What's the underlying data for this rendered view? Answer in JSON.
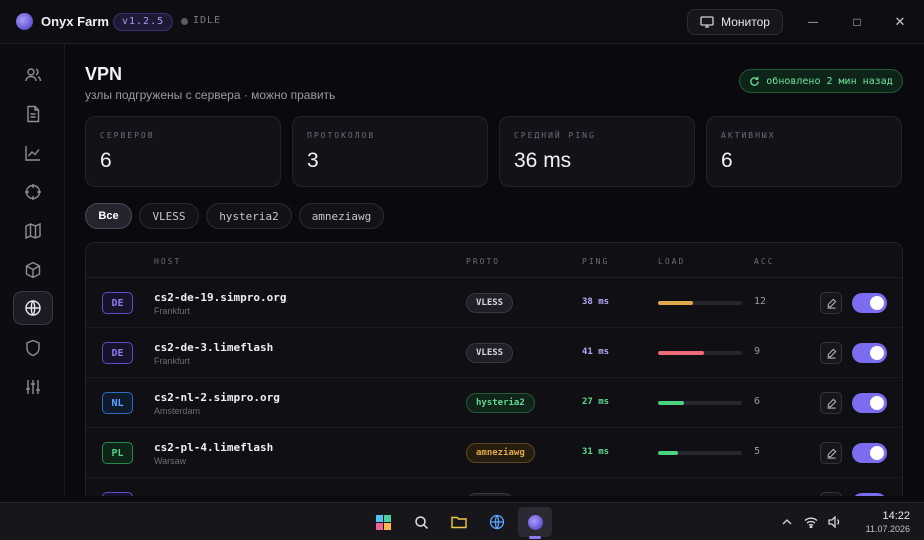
{
  "app": {
    "title": "Onyx Farm",
    "version": "v1.2.5",
    "status": "IDLE",
    "monitor_label": "Монитор",
    "window_controls": {
      "minimize": "—",
      "maximize": "□",
      "close": "✕"
    }
  },
  "sidebar": {
    "items": [
      {
        "name": "users-icon"
      },
      {
        "name": "document-icon"
      },
      {
        "name": "chart-icon"
      },
      {
        "name": "crosshair-icon"
      },
      {
        "name": "map-icon"
      },
      {
        "name": "box-icon"
      },
      {
        "name": "globe-icon",
        "active": true
      },
      {
        "name": "shield-icon"
      },
      {
        "name": "sliders-icon"
      }
    ]
  },
  "page": {
    "title": "VPN",
    "subtitle": "узлы подгружены с сервера · можно править",
    "updated_label": "обновлено 2 мин назад"
  },
  "stats": [
    {
      "label": "СЕРВЕРОВ",
      "value": "6"
    },
    {
      "label": "ПРОТОКОЛОВ",
      "value": "3"
    },
    {
      "label": "СРЕДНИЙ PING",
      "value": "36 ms"
    },
    {
      "label": "АКТИВНЫХ",
      "value": "6"
    }
  ],
  "filters": [
    {
      "label": "Все",
      "active": true
    },
    {
      "label": "VLESS"
    },
    {
      "label": "hysteria2"
    },
    {
      "label": "amneziawg"
    }
  ],
  "table": {
    "headers": {
      "host": "HOST",
      "proto": "PROTO",
      "ping": "PING",
      "load": "LOAD",
      "acc": "ACC"
    },
    "rows": [
      {
        "cc": "DE",
        "host": "cs2-de-19.simpro.org",
        "city": "Frankfurt",
        "proto": "VLESS",
        "ping": "38 ms",
        "load": 0.42,
        "load_color": "#e0a94c",
        "acc": "12"
      },
      {
        "cc": "DE",
        "host": "cs2-de-3.limeflash",
        "city": "Frankfurt",
        "proto": "VLESS",
        "ping": "41 ms",
        "load": 0.55,
        "load_color": "#ef6b7a",
        "acc": "9"
      },
      {
        "cc": "NL",
        "host": "cs2-nl-2.simpro.org",
        "city": "Amsterdam",
        "proto": "hysteria2",
        "ping": "27 ms",
        "load": 0.31,
        "load_color": "#4cd37f",
        "acc": "6"
      },
      {
        "cc": "PL",
        "host": "cs2-pl-4.limeflash",
        "city": "Warsaw",
        "proto": "amneziawg",
        "ping": "31 ms",
        "load": 0.24,
        "load_color": "#4cd37f",
        "acc": "5"
      }
    ]
  },
  "colors": {
    "accent": "#7b6cf0",
    "cc_de": "#8a7cf0",
    "cc_nl": "#5aa7ff",
    "cc_pl": "#4cd37f",
    "proto_vless": "#d6d6de",
    "proto_hysteria2": "#5fd88f",
    "proto_amneziawg": "#e0a94c"
  },
  "taskbar": {
    "icons": [
      "windows-start-icon",
      "search-icon",
      "folder-icon",
      "browser-icon",
      "onyx-app-icon"
    ],
    "tray": [
      "chevron-up-icon",
      "wifi-icon",
      "volume-icon"
    ],
    "time": "14:22",
    "date": "11.07.2026"
  }
}
